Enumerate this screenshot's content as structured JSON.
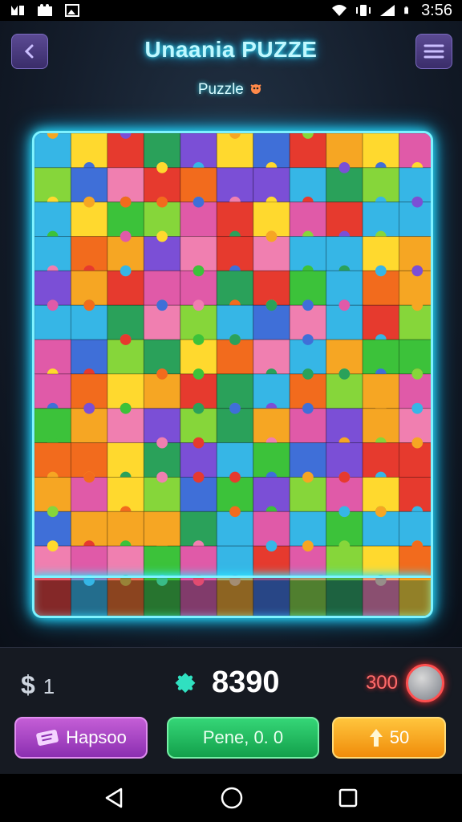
{
  "status_bar": {
    "time": "3:56",
    "left_icons": [
      "notification-icon",
      "media-icon",
      "image-icon"
    ],
    "right_icons": [
      "wifi-icon",
      "vibrate-icon",
      "signal-icon",
      "battery-icon"
    ]
  },
  "header": {
    "title": "Unaania PUZZE",
    "subtitle": "Puzzle",
    "back_icon": "chevron-left-icon",
    "menu_icon": "hamburger-icon"
  },
  "board": {
    "grid_cols": 11,
    "grid_rows": 13,
    "tray_slots": 11,
    "palette": [
      "#e63a2e",
      "#f6a623",
      "#ffd92e",
      "#3cc23a",
      "#2aa15a",
      "#36b6e6",
      "#3f6fd8",
      "#7b4fd6",
      "#e05aa8",
      "#f07fb0",
      "#f26b1d",
      "#86d63a"
    ],
    "accent": "#7ef2ff"
  },
  "stats": {
    "coins_symbol": "$",
    "coins_value": "1",
    "score_icon": "puzzle-piece-icon",
    "score_value": "8390",
    "opponent_value": "300"
  },
  "buttons": {
    "left_label": "Hapsoo",
    "left_icon": "ticket-icon",
    "middle_label": "Pene, 0. 0",
    "right_label": "50",
    "right_icon": "arrow-up-icon"
  },
  "navbar": {
    "back": "back-triangle-icon",
    "home": "home-circle-icon",
    "recents": "recents-square-icon"
  }
}
